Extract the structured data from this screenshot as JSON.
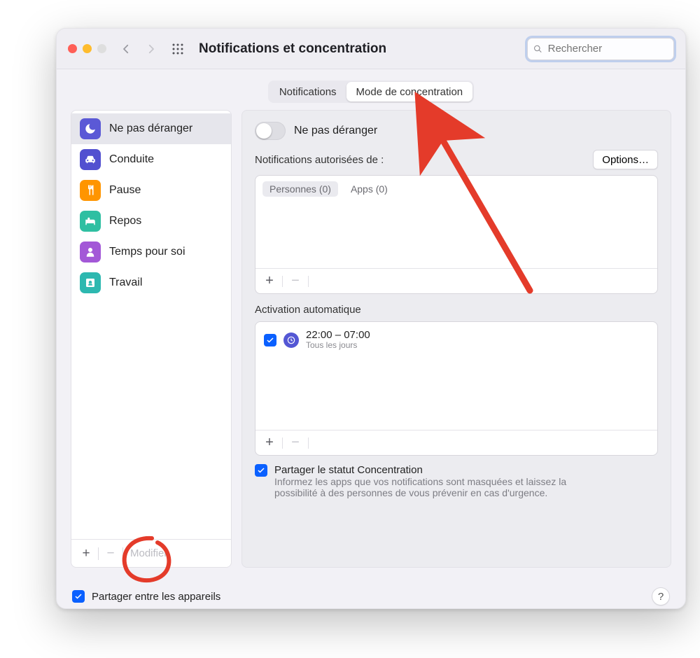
{
  "window": {
    "title": "Notifications et concentration",
    "search_placeholder": "Rechercher"
  },
  "tabs": {
    "notifications": "Notifications",
    "focus": "Mode de concentration"
  },
  "sidebar": {
    "items": [
      {
        "label": "Ne pas déranger",
        "icon": "moon-icon",
        "color": "#5b59d6",
        "selected": true
      },
      {
        "label": "Conduite",
        "icon": "car-icon",
        "color": "#5250d0"
      },
      {
        "label": "Pause",
        "icon": "fork-icon",
        "color": "#ff9500"
      },
      {
        "label": "Repos",
        "icon": "bed-icon",
        "color": "#2fbfa2"
      },
      {
        "label": "Temps pour soi",
        "icon": "person-icon",
        "color": "#a358d7"
      },
      {
        "label": "Travail",
        "icon": "badge-icon",
        "color": "#2db8b0"
      }
    ],
    "footer": {
      "modify": "Modifier"
    }
  },
  "detail": {
    "toggle_label": "Ne pas déranger",
    "allowed_label": "Notifications autorisées de :",
    "options_btn": "Options…",
    "tabs": {
      "people": "Personnes (0)",
      "apps": "Apps (0)"
    },
    "auto_label": "Activation automatique",
    "schedule": {
      "time": "22:00 – 07:00",
      "sub": "Tous les jours",
      "enabled": true
    },
    "share_title": "Partager le statut Concentration",
    "share_desc": "Informez les apps que vos notifications sont masquées et laissez la possibilité à des personnes de vous prévenir en cas d'urgence."
  },
  "bottom": {
    "share_devices": "Partager entre les appareils"
  }
}
